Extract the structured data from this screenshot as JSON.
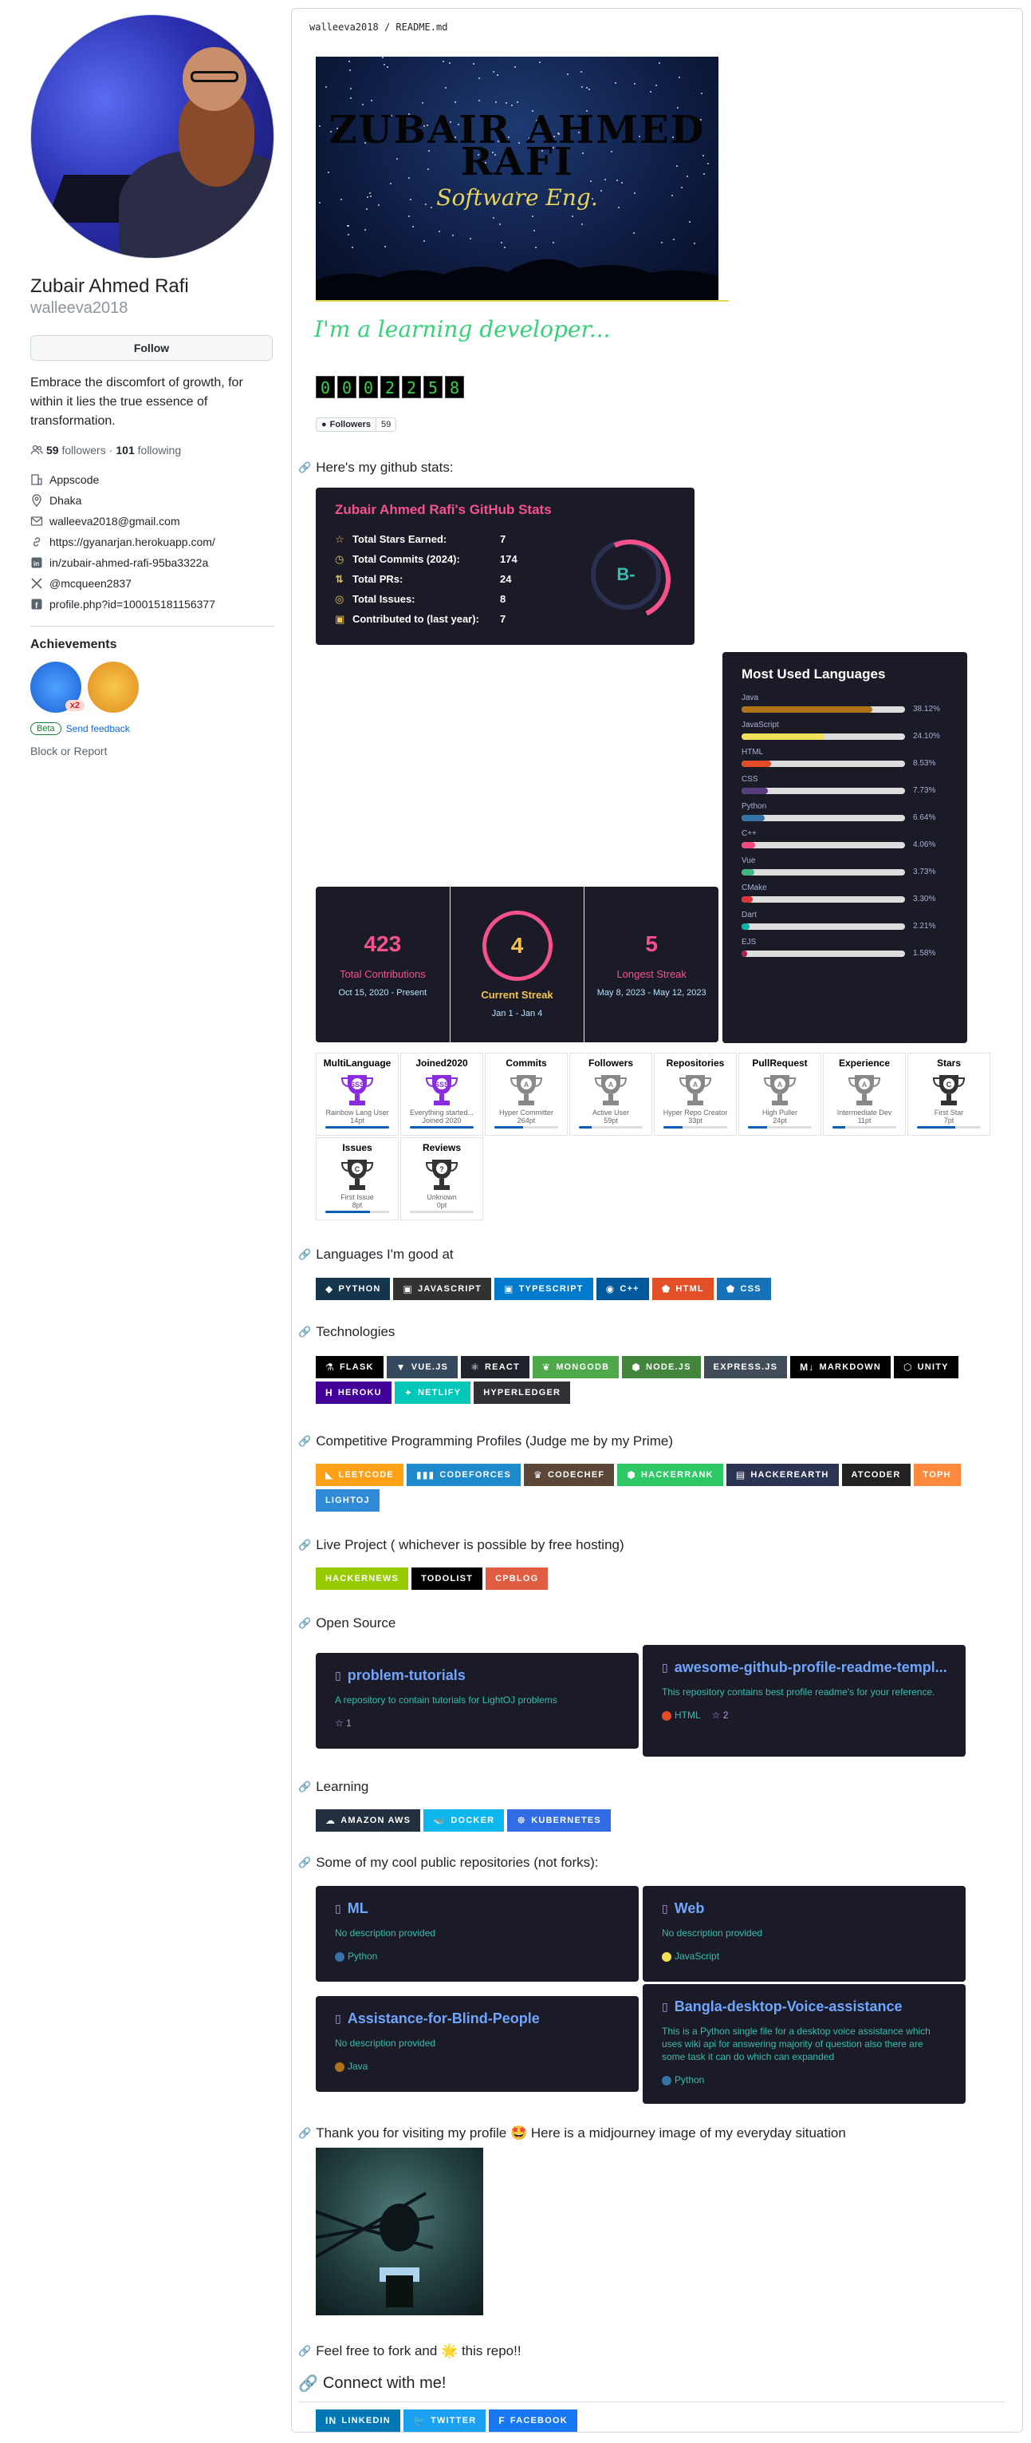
{
  "profile": {
    "full_name": "Zubair Ahmed Rafi",
    "username": "walleeva2018",
    "follow_label": "Follow",
    "bio": "Embrace the discomfort of growth, for within it lies the true essence of transformation.",
    "followers_count": "59",
    "followers_label": "followers",
    "following_count": "101",
    "following_label": "following",
    "separator": "·",
    "org": "Appscode",
    "location": "Dhaka",
    "email": "walleeva2018@gmail.com",
    "website": "https://gyanarjan.herokuapp.com/",
    "linkedin": "in/zubair-ahmed-rafi-95ba3322a",
    "twitter": "@mcqueen2837",
    "facebook": "profile.php?id=100015181156377",
    "achievements_title": "Achievements",
    "achievement_multiplier": "x2",
    "beta_label": "Beta",
    "feedback_label": "Send feedback",
    "block_label": "Block or Report"
  },
  "readme": {
    "path_user": "walleeva2018",
    "path_sep": "/",
    "path_file": "README.md",
    "banner_title": "ZUBAIR AHMED RAFI",
    "banner_subtitle": "Software Eng.",
    "typing_text": "I'm a learning developer...",
    "counter_digits": [
      "0",
      "0",
      "0",
      "2",
      "2",
      "5",
      "8"
    ],
    "followers_badge_label": "Followers",
    "followers_badge_count": "59",
    "section_stats": "Here's my github stats:",
    "section_languages": "Languages I'm good at",
    "section_tech": "Technologies",
    "section_cp": "Competitive Programming Profiles (Judge me by my Prime)",
    "section_live": "Live Project ( whichever is possible by free hosting)",
    "section_os": "Open Source",
    "section_learning": "Learning",
    "section_repos": "Some of my cool public repositories (not forks):",
    "section_thanks": "Thank you for visiting my profile 🤩 Here is a midjourney image of my everyday situation",
    "section_fork": "Feel free to fork and 🌟 this repo!!",
    "section_connect": "Connect with me!"
  },
  "stats_card": {
    "title": "Zubair Ahmed Rafi's GitHub Stats",
    "rows": [
      {
        "label": "Total Stars Earned:",
        "value": "7"
      },
      {
        "label": "Total Commits (2024):",
        "value": "174"
      },
      {
        "label": "Total PRs:",
        "value": "24"
      },
      {
        "label": "Total Issues:",
        "value": "8"
      },
      {
        "label": "Contributed to (last year):",
        "value": "7"
      }
    ],
    "grade": "B-"
  },
  "lang_card": {
    "title": "Most Used Languages",
    "items": [
      {
        "name": "Java",
        "pct": "38.12%",
        "value": 38.12,
        "color": "#b07219"
      },
      {
        "name": "JavaScript",
        "pct": "24.10%",
        "value": 24.1,
        "color": "#f1e05a"
      },
      {
        "name": "HTML",
        "pct": "8.53%",
        "value": 8.53,
        "color": "#e34c26"
      },
      {
        "name": "CSS",
        "pct": "7.73%",
        "value": 7.73,
        "color": "#563d7c"
      },
      {
        "name": "Python",
        "pct": "6.64%",
        "value": 6.64,
        "color": "#3572A5"
      },
      {
        "name": "C++",
        "pct": "4.06%",
        "value": 4.06,
        "color": "#f34b7d"
      },
      {
        "name": "Vue",
        "pct": "3.73%",
        "value": 3.73,
        "color": "#41b883"
      },
      {
        "name": "CMake",
        "pct": "3.30%",
        "value": 3.3,
        "color": "#DA3434"
      },
      {
        "name": "Dart",
        "pct": "2.21%",
        "value": 2.21,
        "color": "#00B4AB"
      },
      {
        "name": "EJS",
        "pct": "1.58%",
        "value": 1.58,
        "color": "#a91e50"
      }
    ]
  },
  "streak_card": {
    "total": "423",
    "total_label": "Total Contributions",
    "total_range": "Oct 15, 2020 - Present",
    "current": "4",
    "current_label": "Current Streak",
    "current_range": "Jan 1 - Jan 4",
    "longest": "5",
    "longest_label": "Longest Streak",
    "longest_range": "May 8, 2023 - May 12, 2023"
  },
  "trophies": [
    {
      "name": "MultiLanguage",
      "grade": "SSS",
      "title": "Rainbow Lang User",
      "pt": "14pt",
      "progress": 1.0,
      "color": "#8a2be2"
    },
    {
      "name": "Joined2020",
      "grade": "SSS",
      "title": "Everything started...",
      "pt": "Joined 2020",
      "progress": 1.0,
      "color": "#8a2be2"
    },
    {
      "name": "Commits",
      "grade": "A",
      "title": "Hyper Committer",
      "pt": "264pt",
      "progress": 0.45,
      "color": "#888888"
    },
    {
      "name": "Followers",
      "grade": "A",
      "title": "Active User",
      "pt": "59pt",
      "progress": 0.2,
      "color": "#888888"
    },
    {
      "name": "Repositories",
      "grade": "A",
      "title": "Hyper Repo Creator",
      "pt": "33pt",
      "progress": 0.3,
      "color": "#888888"
    },
    {
      "name": "PullRequest",
      "grade": "A",
      "title": "High Puller",
      "pt": "24pt",
      "progress": 0.3,
      "color": "#888888"
    },
    {
      "name": "Experience",
      "grade": "A",
      "title": "Intermediate Dev",
      "pt": "11pt",
      "progress": 0.2,
      "color": "#888888"
    },
    {
      "name": "Stars",
      "grade": "C",
      "title": "First Star",
      "pt": "7pt",
      "progress": 0.6,
      "color": "#333333"
    },
    {
      "name": "Issues",
      "grade": "C",
      "title": "First Issue",
      "pt": "8pt",
      "progress": 0.7,
      "color": "#333333"
    },
    {
      "name": "Reviews",
      "grade": "?",
      "title": "Unknown",
      "pt": "0pt",
      "progress": 0.0,
      "color": "#333333"
    }
  ],
  "languages": [
    {
      "label": "Python",
      "bg": "#14354c",
      "icon": "python-icon",
      "glyph": "◆"
    },
    {
      "label": "JavaScript",
      "bg": "#323330",
      "icon": "javascript-icon",
      "glyph": "▣"
    },
    {
      "label": "TypeScript",
      "bg": "#007acc",
      "icon": "typescript-icon",
      "glyph": "▣"
    },
    {
      "label": "C++",
      "bg": "#00599c",
      "icon": "cpp-icon",
      "glyph": "◉"
    },
    {
      "label": "HTML",
      "bg": "#e34f26",
      "icon": "html-icon",
      "glyph": "⬟"
    },
    {
      "label": "CSS",
      "bg": "#1572b6",
      "icon": "css-icon",
      "glyph": "⬟"
    }
  ],
  "tech": [
    {
      "label": "Flask",
      "bg": "#000000",
      "icon": "flask-icon",
      "glyph": "⚗"
    },
    {
      "label": "Vue.js",
      "bg": "#35495e",
      "icon": "vue-icon",
      "glyph": "▼"
    },
    {
      "label": "React",
      "bg": "#20232a",
      "icon": "react-icon",
      "glyph": "⚛"
    },
    {
      "label": "MongoDB",
      "bg": "#4ea94b",
      "icon": "mongodb-icon",
      "glyph": "❦"
    },
    {
      "label": "Node.js",
      "bg": "#43853d",
      "icon": "nodejs-icon",
      "glyph": "⬢"
    },
    {
      "label": "Express.js",
      "bg": "#404d59",
      "icon": "express-icon",
      "glyph": ""
    },
    {
      "label": "Markdown",
      "bg": "#000000",
      "icon": "markdown-icon",
      "glyph": "M↓"
    },
    {
      "label": "Unity",
      "bg": "#000000",
      "icon": "unity-icon",
      "glyph": "⬡"
    },
    {
      "label": "Heroku",
      "bg": "#430098",
      "icon": "heroku-icon",
      "glyph": "h"
    },
    {
      "label": "Netlify",
      "bg": "#00c7b7",
      "icon": "netlify-icon",
      "glyph": "✦"
    },
    {
      "label": "Hyperledger",
      "bg": "#2f3134",
      "icon": "hyperledger-icon",
      "glyph": ""
    }
  ],
  "cp": [
    {
      "label": "LeetCode",
      "bg": "#ffa116",
      "icon": "leetcode-icon",
      "glyph": "◣"
    },
    {
      "label": "Codeforces",
      "bg": "#1f8acb",
      "icon": "codeforces-icon",
      "glyph": "▮▮▮"
    },
    {
      "label": "CodeChef",
      "bg": "#5b4638",
      "icon": "codechef-icon",
      "glyph": "♛"
    },
    {
      "label": "HackerRank",
      "bg": "#2ec866",
      "icon": "hackerrank-icon",
      "glyph": "⬢"
    },
    {
      "label": "HackerEarth",
      "bg": "#2c3454",
      "icon": "hackerearth-icon",
      "glyph": "▤"
    },
    {
      "label": "AtCoder",
      "bg": "#222222",
      "icon": "",
      "glyph": ""
    },
    {
      "label": "TOPH",
      "bg": "#ff8a3d",
      "icon": "",
      "glyph": ""
    },
    {
      "label": "LightOJ",
      "bg": "#2f8bd8",
      "icon": "",
      "glyph": ""
    }
  ],
  "live": [
    {
      "label": "HackerNews",
      "bg": "#97ca00",
      "icon": "",
      "glyph": ""
    },
    {
      "label": "ToDoList",
      "bg": "#000000",
      "icon": "",
      "glyph": ""
    },
    {
      "label": "CPBlog",
      "bg": "#e05d44",
      "icon": "",
      "glyph": ""
    }
  ],
  "learning": [
    {
      "label": "Amazon AWS",
      "bg": "#232f3e",
      "icon": "aws-icon",
      "glyph": "☁"
    },
    {
      "label": "Docker",
      "bg": "#0db7ed",
      "icon": "docker-icon",
      "glyph": "🐳"
    },
    {
      "label": "Kubernetes",
      "bg": "#326ce5",
      "icon": "kubernetes-icon",
      "glyph": "☸"
    }
  ],
  "connect": [
    {
      "label": "LinkedIn",
      "bg": "#0077b5",
      "icon": "linkedin-icon",
      "glyph": "in"
    },
    {
      "label": "Twitter",
      "bg": "#1ca0f1",
      "icon": "twitter-icon",
      "glyph": "🐦"
    },
    {
      "label": "Facebook",
      "bg": "#1877f2",
      "icon": "facebook-icon",
      "glyph": "f"
    }
  ],
  "os_repos": [
    {
      "name": "problem-tutorials",
      "desc": "A repository to contain tutorials for LightOJ problems",
      "lang": "",
      "lang_color": "",
      "stars": "1"
    },
    {
      "name": "awesome-github-profile-readme-templ...",
      "desc": "This repository contains best profile readme's for your reference.",
      "lang": "HTML",
      "lang_color": "#e34c26",
      "stars": "2"
    }
  ],
  "cool_repos": [
    {
      "name": "ML",
      "desc": "No description provided",
      "lang": "Python",
      "lang_color": "#3572A5"
    },
    {
      "name": "Web",
      "desc": "No description provided",
      "lang": "JavaScript",
      "lang_color": "#f1e05a"
    },
    {
      "name": "Assistance-for-Blind-People",
      "desc": "No description provided",
      "lang": "Java",
      "lang_color": "#b07219"
    },
    {
      "name": "Bangla-desktop-Voice-assistance",
      "desc": "This is a Python single file for a desktop voice assistance which uses wiki api for answering majority of question also there are some task it can do which can expanded",
      "lang": "Python",
      "lang_color": "#3572A5"
    }
  ]
}
